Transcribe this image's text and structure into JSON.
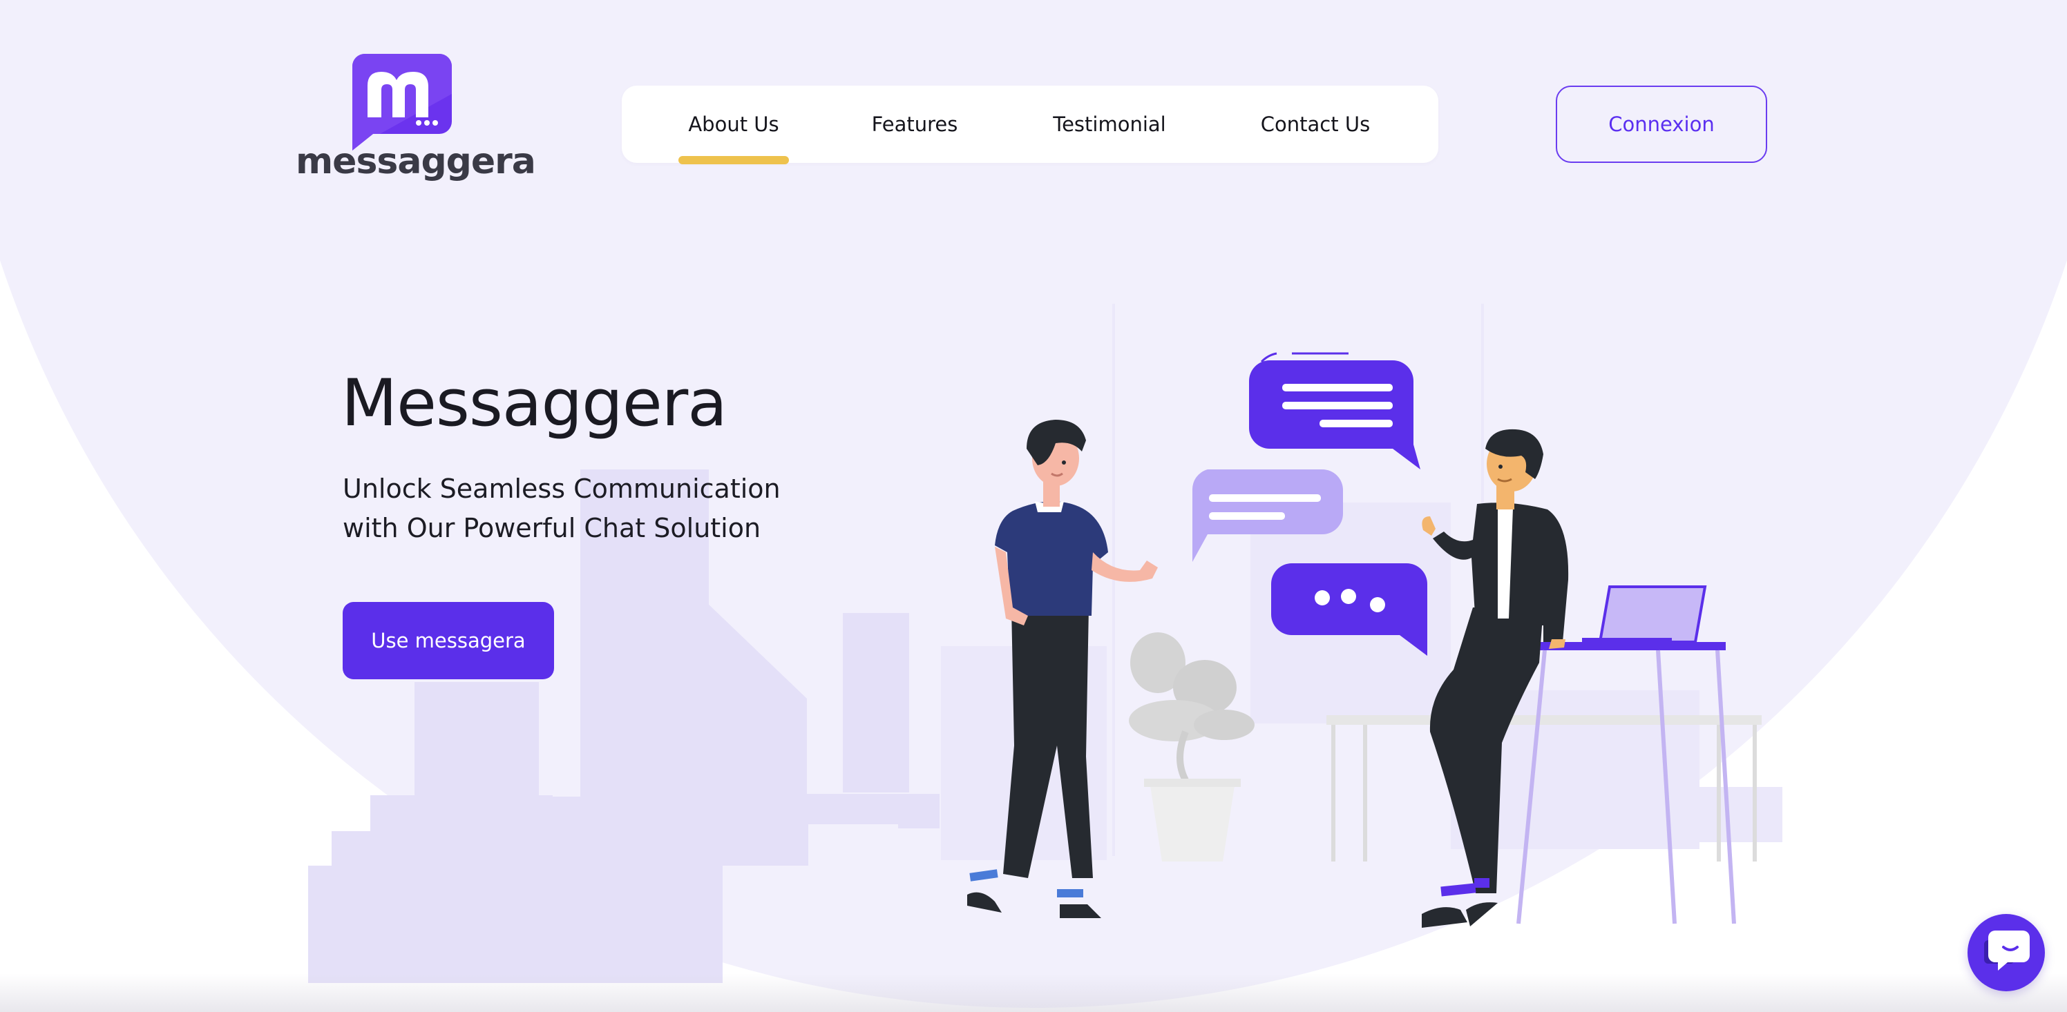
{
  "brand": {
    "name": "messaggera",
    "logo_icon": "messaggera-chat-logo-icon",
    "primary_color": "#5b2fea",
    "accent_color": "#eec24d",
    "background_color": "#f2f0fc"
  },
  "nav": {
    "items": [
      {
        "label": "About Us",
        "active": true
      },
      {
        "label": "Features",
        "active": false
      },
      {
        "label": "Testimonial",
        "active": false
      },
      {
        "label": "Contact Us",
        "active": false
      }
    ]
  },
  "header": {
    "connexion_label": "Connexion"
  },
  "hero": {
    "title": "Messaggera",
    "subtitle_line1": "Unlock Seamless Communication",
    "subtitle_line2": "with Our Powerful Chat Solution",
    "cta_label": "Use messagera",
    "illustration": "two-people-chatting-illustration"
  },
  "chat_widget": {
    "icon": "chat-bubble-icon"
  }
}
